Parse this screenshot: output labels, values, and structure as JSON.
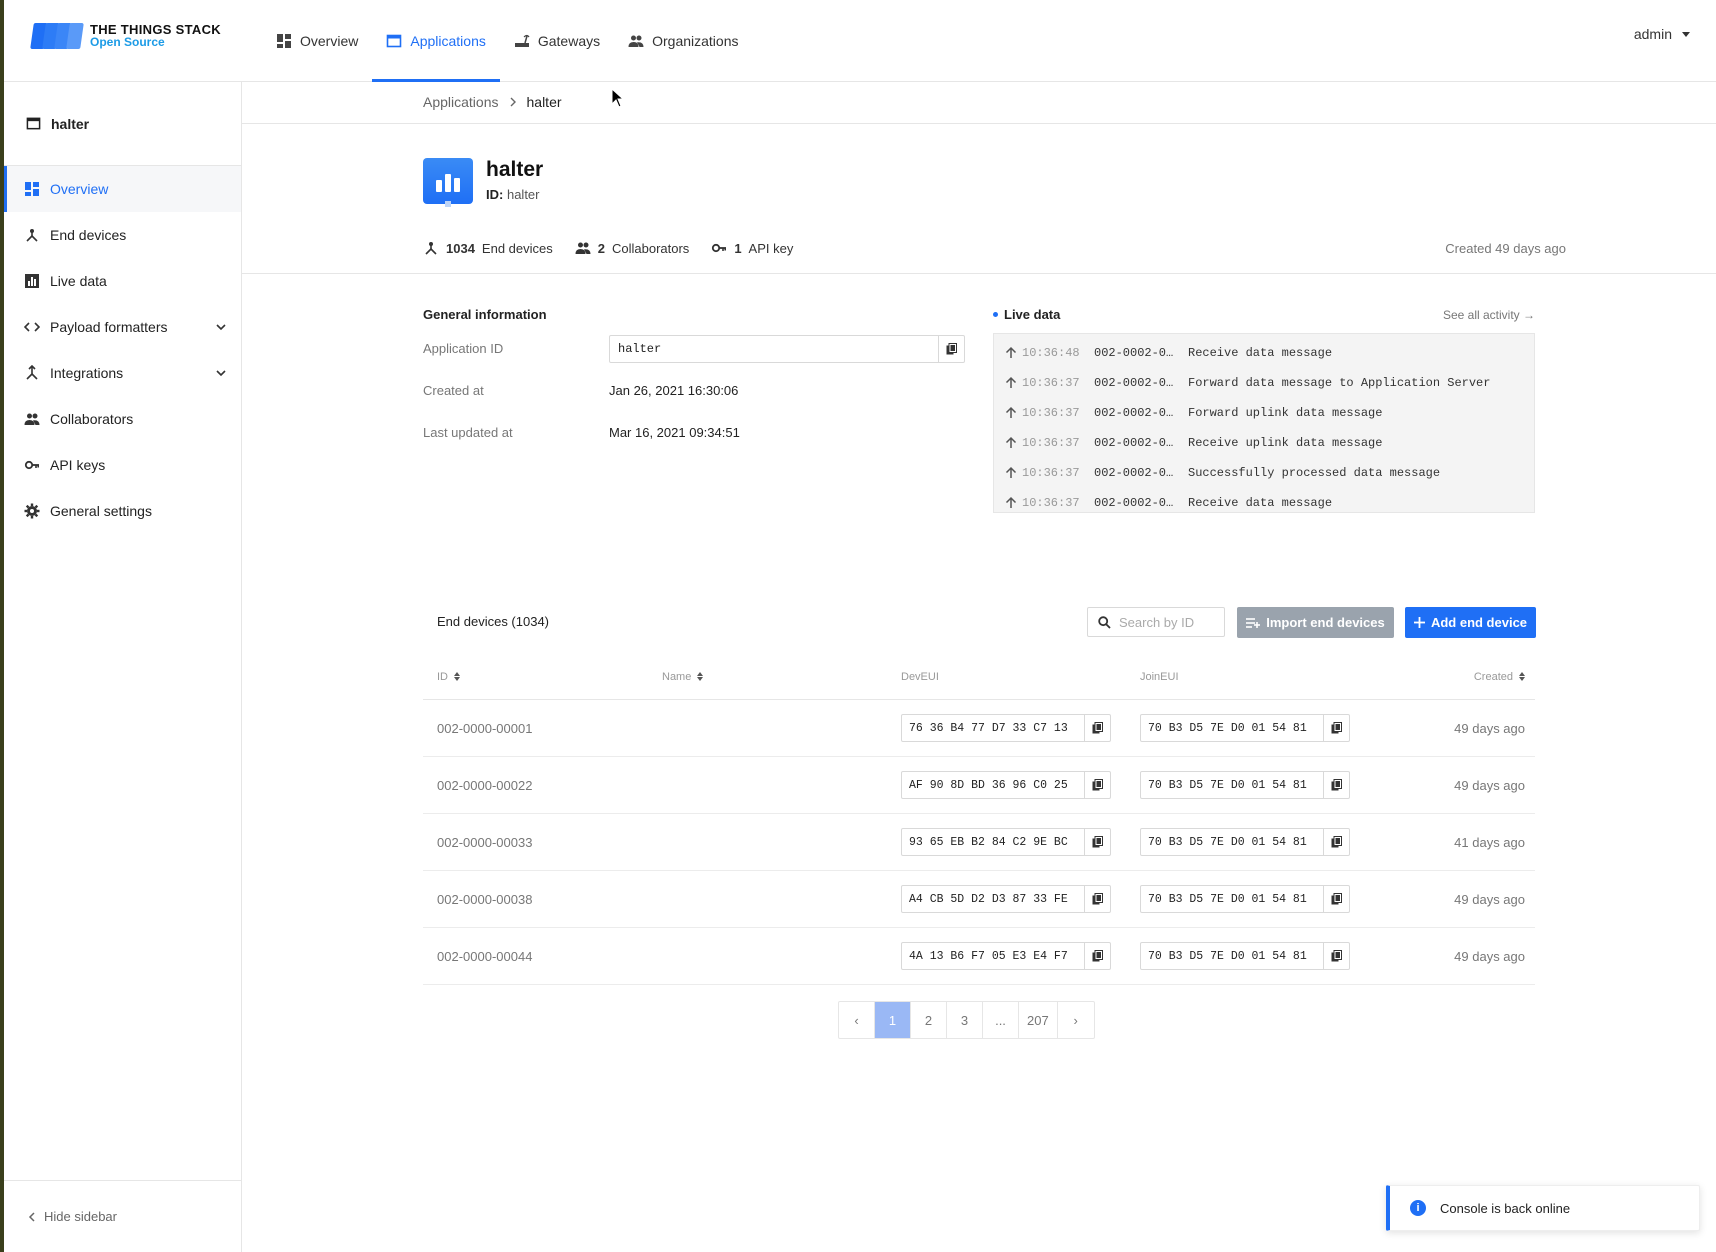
{
  "brand": {
    "line1": "THE THINGS STACK",
    "line2": "Open Source"
  },
  "nav": [
    {
      "label": "Overview",
      "icon": "grid-icon"
    },
    {
      "label": "Applications",
      "icon": "window-icon",
      "active": true
    },
    {
      "label": "Gateways",
      "icon": "gateway-icon"
    },
    {
      "label": "Organizations",
      "icon": "people-icon"
    }
  ],
  "user": {
    "name": "admin"
  },
  "sidebar": {
    "app_name": "halter",
    "items": [
      {
        "label": "Overview",
        "icon": "grid-icon",
        "active": true
      },
      {
        "label": "End devices",
        "icon": "device-icon"
      },
      {
        "label": "Live data",
        "icon": "chart-icon"
      },
      {
        "label": "Payload formatters",
        "icon": "code-icon",
        "expandable": true
      },
      {
        "label": "Integrations",
        "icon": "integration-icon",
        "expandable": true
      },
      {
        "label": "Collaborators",
        "icon": "people-icon"
      },
      {
        "label": "API keys",
        "icon": "key-icon"
      },
      {
        "label": "General settings",
        "icon": "gear-icon"
      }
    ],
    "hide_label": "Hide sidebar"
  },
  "breadcrumb": {
    "parent": "Applications",
    "current": "halter"
  },
  "app": {
    "name": "halter",
    "id_label": "ID:",
    "id_value": "halter",
    "end_devices_count": "1034",
    "end_devices_label": "End devices",
    "collaborators_count": "2",
    "collaborators_label": "Collaborators",
    "api_keys_count": "1",
    "api_keys_label": "API key",
    "created_ago": "Created 49 days ago"
  },
  "general": {
    "title": "General information",
    "app_id_label": "Application ID",
    "app_id_value": "halter",
    "created_label": "Created at",
    "created_value": "Jan 26, 2021 16:30:06",
    "updated_label": "Last updated at",
    "updated_value": "Mar 16, 2021 09:34:51"
  },
  "live": {
    "title": "Live data",
    "see_all": "See all activity →",
    "rows": [
      {
        "time": "10:36:48",
        "device": "002-0002-0…",
        "message": "Receive data message"
      },
      {
        "time": "10:36:37",
        "device": "002-0002-0…",
        "message": "Forward data message to Application Server"
      },
      {
        "time": "10:36:37",
        "device": "002-0002-0…",
        "message": "Forward uplink data message"
      },
      {
        "time": "10:36:37",
        "device": "002-0002-0…",
        "message": "Receive uplink data message"
      },
      {
        "time": "10:36:37",
        "device": "002-0002-0…",
        "message": "Successfully processed data message"
      },
      {
        "time": "10:36:37",
        "device": "002-0002-0…",
        "message": "Receive data message"
      }
    ]
  },
  "end_devices": {
    "title": "End devices (1034)",
    "search_placeholder": "Search by ID",
    "import_label": "Import end devices",
    "add_label": "Add end device",
    "columns": {
      "id": "ID",
      "name": "Name",
      "deveui": "DevEUI",
      "joineui": "JoinEUI",
      "created": "Created"
    },
    "rows": [
      {
        "id": "002-0000-00001",
        "name": "",
        "deveui": "76 36 B4 77 D7 33 C7 13",
        "joineui": "70 B3 D5 7E D0 01 54 81",
        "created": "49 days ago"
      },
      {
        "id": "002-0000-00022",
        "name": "",
        "deveui": "AF 90 8D BD 36 96 C0 25",
        "joineui": "70 B3 D5 7E D0 01 54 81",
        "created": "49 days ago"
      },
      {
        "id": "002-0000-00033",
        "name": "",
        "deveui": "93 65 EB B2 84 C2 9E BC",
        "joineui": "70 B3 D5 7E D0 01 54 81",
        "created": "41 days ago"
      },
      {
        "id": "002-0000-00038",
        "name": "",
        "deveui": "A4 CB 5D D2 D3 87 33 FE",
        "joineui": "70 B3 D5 7E D0 01 54 81",
        "created": "49 days ago"
      },
      {
        "id": "002-0000-00044",
        "name": "",
        "deveui": "4A 13 B6 F7 05 E3 E4 F7",
        "joineui": "70 B3 D5 7E D0 01 54 81",
        "created": "49 days ago"
      }
    ]
  },
  "pagination": {
    "prev": "‹",
    "pages": [
      "1",
      "2",
      "3",
      "...",
      "207"
    ],
    "next": "›",
    "current": "1"
  },
  "toast": {
    "message": "Console is back online"
  },
  "colors": {
    "accent": "#1f6ff5",
    "brand_secondary": "#1c9be6",
    "disabled_button": "#9aa3ad"
  }
}
